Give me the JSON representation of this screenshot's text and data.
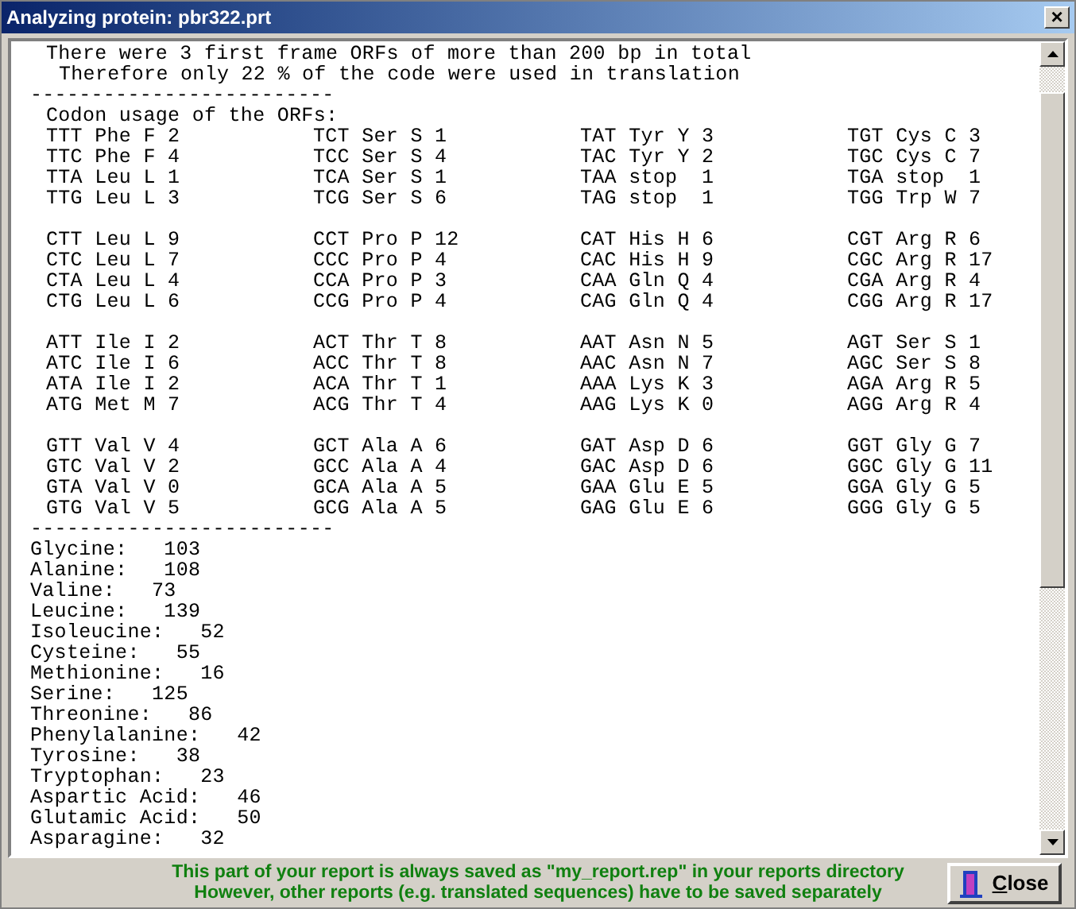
{
  "window": {
    "title": "Analyzing protein: pbr322.prt",
    "close": "×"
  },
  "report": {
    "intro": [
      "There were 3 first frame ORFs of more than 200 bp in total",
      "Therefore only 22 % of the code were used in translation"
    ],
    "rule_top": "-------------------------",
    "codon_title": "Codon usage of the ORFs:",
    "codon_blocks": [
      [
        [
          "TTT Phe F 2",
          "TCT Ser S 1",
          "TAT Tyr Y 3",
          "TGT Cys C 3"
        ],
        [
          "TTC Phe F 4",
          "TCC Ser S 4",
          "TAC Tyr Y 2",
          "TGC Cys C 7"
        ],
        [
          "TTA Leu L 1",
          "TCA Ser S 1",
          "TAA stop  1",
          "TGA stop  1"
        ],
        [
          "TTG Leu L 3",
          "TCG Ser S 6",
          "TAG stop  1",
          "TGG Trp W 7"
        ]
      ],
      [
        [
          "CTT Leu L 9",
          "CCT Pro P 12",
          "CAT His H 6",
          "CGT Arg R 6"
        ],
        [
          "CTC Leu L 7",
          "CCC Pro P 4",
          "CAC His H 9",
          "CGC Arg R 17"
        ],
        [
          "CTA Leu L 4",
          "CCA Pro P 3",
          "CAA Gln Q 4",
          "CGA Arg R 4"
        ],
        [
          "CTG Leu L 6",
          "CCG Pro P 4",
          "CAG Gln Q 4",
          "CGG Arg R 17"
        ]
      ],
      [
        [
          "ATT Ile I 2",
          "ACT Thr T 8",
          "AAT Asn N 5",
          "AGT Ser S 1"
        ],
        [
          "ATC Ile I 6",
          "ACC Thr T 8",
          "AAC Asn N 7",
          "AGC Ser S 8"
        ],
        [
          "ATA Ile I 2",
          "ACA Thr T 1",
          "AAA Lys K 3",
          "AGA Arg R 5"
        ],
        [
          "ATG Met M 7",
          "ACG Thr T 4",
          "AAG Lys K 0",
          "AGG Arg R 4"
        ]
      ],
      [
        [
          "GTT Val V 4",
          "GCT Ala A 6",
          "GAT Asp D 6",
          "GGT Gly G 7"
        ],
        [
          "GTC Val V 2",
          "GCC Ala A 4",
          "GAC Asp D 6",
          "GGC Gly G 11"
        ],
        [
          "GTA Val V 0",
          "GCA Ala A 5",
          "GAA Glu E 5",
          "GGA Gly G 5"
        ],
        [
          "GTG Val V 5",
          "GCG Ala A 5",
          "GAG Glu E 6",
          "GGG Gly G 5"
        ]
      ]
    ],
    "rule_bottom": "-------------------------",
    "totals": [
      "Glycine:   103",
      "Alanine:   108",
      "Valine:   73",
      "Leucine:   139",
      "Isoleucine:   52",
      "Cysteine:   55",
      "Methionine:   16",
      "Serine:   125",
      "Threonine:   86",
      "Phenylalanine:   42",
      "Tyrosine:   38",
      "Tryptophan:   23",
      "Aspartic Acid:   46",
      "Glutamic Acid:   50",
      "Asparagine:   32"
    ]
  },
  "footer": {
    "notes": [
      "This part of your report is always saved as \"my_report.rep\" in your reports directory",
      "However, other reports (e.g. translated sequences) have to be saved separately"
    ],
    "close_button": "Close"
  }
}
